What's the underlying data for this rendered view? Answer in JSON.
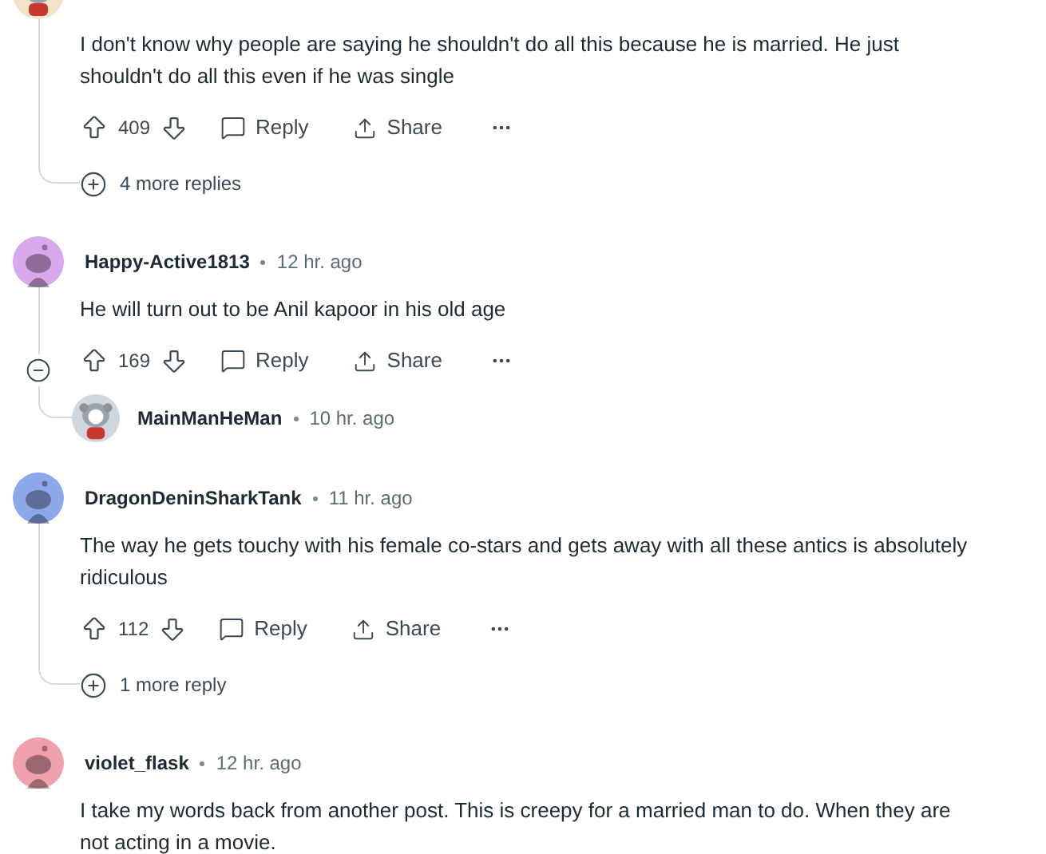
{
  "comments": [
    {
      "avatar": {
        "color": "#f3e3c8",
        "kind": "custom"
      },
      "body": "I don't know why people are saying he shouldn't do all this because he is married. He just shouldn't do all this even if he was single",
      "votes": "409",
      "reply": "Reply",
      "share": "Share",
      "more_replies": "4 more replies"
    },
    {
      "avatar": {
        "color": "#d9a8ea",
        "kind": "snoo"
      },
      "author": "Happy-Active1813",
      "time": "12 hr. ago",
      "body": "He will turn out to be Anil kapoor in his old age",
      "votes": "169",
      "reply": "Reply",
      "share": "Share",
      "expanded": true,
      "children": [
        {
          "avatar": {
            "color": "#cfd6dc",
            "kind": "custom"
          },
          "author": "MainManHeMan",
          "time": "10 hr. ago"
        }
      ]
    },
    {
      "avatar": {
        "color": "#8ea7ea",
        "kind": "snoo"
      },
      "author": "DragonDeninSharkTank",
      "time": "11 hr. ago",
      "body": "The way he gets touchy with his female co-stars and gets away with all these antics is absolutely ridiculous",
      "votes": "112",
      "reply": "Reply",
      "share": "Share",
      "more_replies": "1 more reply"
    },
    {
      "avatar": {
        "color": "#f0a0ad",
        "kind": "snoo"
      },
      "author": "violet_flask",
      "time": "12 hr. ago",
      "body": "I take my words back from another post. This is creepy for a married man to do. When they are not acting in a movie."
    }
  ]
}
